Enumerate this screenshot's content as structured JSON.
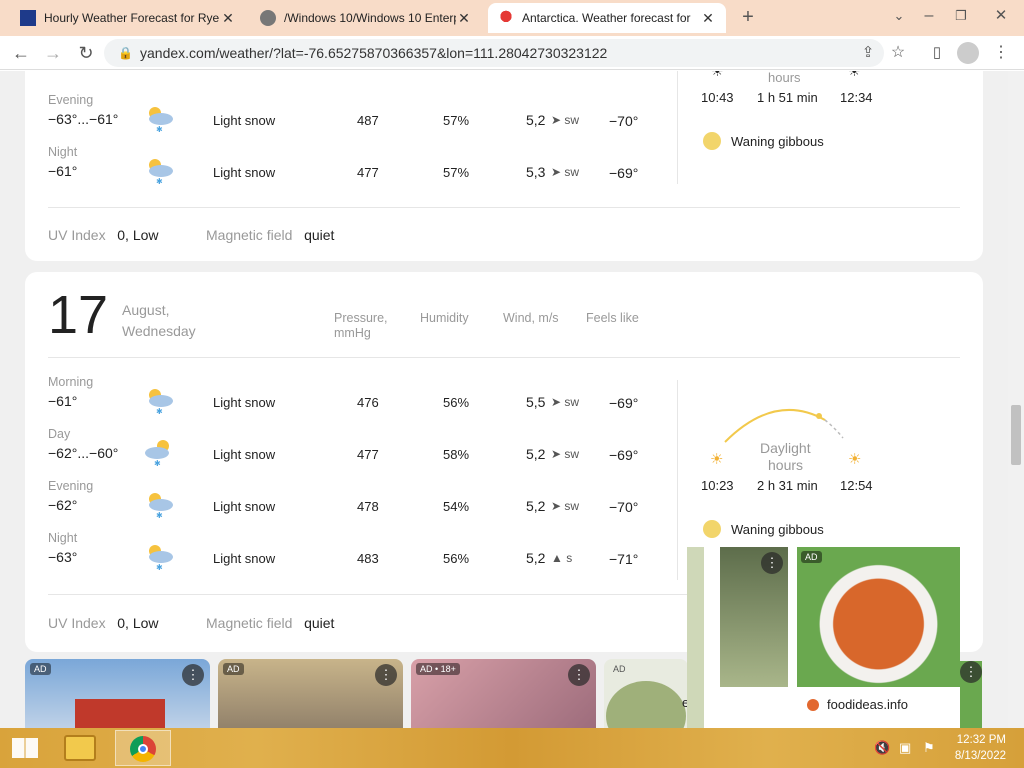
{
  "tabs": [
    {
      "title": "Hourly Weather Forecast for Rye"
    },
    {
      "title": "/Windows 10/Windows 10 Enterp"
    },
    {
      "title": "Antarctica. Weather forecast for"
    }
  ],
  "address": {
    "url": "yandex.com/weather/?lat=-76.65275870366357&lon=111.28042730323122"
  },
  "day1": {
    "rows": [
      {
        "period": "Evening",
        "temp": "−63°...−61°",
        "cond": "Light snow",
        "press": "487",
        "hum": "57%",
        "wind": "5,2",
        "dir": "sw",
        "feel": "−70°"
      },
      {
        "period": "Night",
        "temp": "−61°",
        "cond": "Light snow",
        "press": "477",
        "hum": "57%",
        "wind": "5,3",
        "dir": "sw",
        "feel": "−69°"
      }
    ],
    "uv_label": "UV Index",
    "uv_value": "0, Low",
    "mag_label": "Magnetic field",
    "mag_value": "quiet",
    "sun": {
      "hours_label": "hours",
      "sunrise": "10:43",
      "length": "1 h 51 min",
      "sunset": "12:34"
    },
    "moon": "Waning gibbous"
  },
  "day2": {
    "date": "17",
    "month": "August,",
    "weekday": "Wednesday",
    "headers": {
      "pressure": "Pressure,",
      "pressure_unit": "mmHg",
      "humidity": "Humidity",
      "wind": "Wind, m/s",
      "feels": "Feels like"
    },
    "rows": [
      {
        "period": "Morning",
        "temp": "−61°",
        "cond": "Light snow",
        "press": "476",
        "hum": "56%",
        "wind": "5,5",
        "dir": "sw",
        "feel": "−69°"
      },
      {
        "period": "Day",
        "temp": "−62°...−60°",
        "cond": "Light snow",
        "press": "477",
        "hum": "58%",
        "wind": "5,2",
        "dir": "sw",
        "feel": "−69°"
      },
      {
        "period": "Evening",
        "temp": "−62°",
        "cond": "Light snow",
        "press": "478",
        "hum": "54%",
        "wind": "5,2",
        "dir": "sw",
        "feel": "−70°"
      },
      {
        "period": "Night",
        "temp": "−63°",
        "cond": "Light snow",
        "press": "483",
        "hum": "56%",
        "wind": "5,2",
        "dir": "s",
        "feel": "−71°"
      }
    ],
    "uv_label": "UV Index",
    "uv_value": "0, Low",
    "mag_label": "Magnetic field",
    "mag_value": "quiet",
    "sun": {
      "daylight_label": "Daylight",
      "hours_label": "hours",
      "sunrise": "10:23",
      "length": "2 h 31 min",
      "sunset": "12:54"
    },
    "moon": "Waning gibbous"
  },
  "ads": [
    {
      "tag": "AD"
    },
    {
      "tag": "AD"
    },
    {
      "tag": "AD • 18+"
    },
    {
      "tag": "AD"
    },
    {
      "tag": "AD"
    }
  ],
  "popup_ad": {
    "source": "foodideas.info",
    "partial_text": "et"
  },
  "clock": {
    "time": "12:32 PM",
    "date": "8/13/2022"
  }
}
